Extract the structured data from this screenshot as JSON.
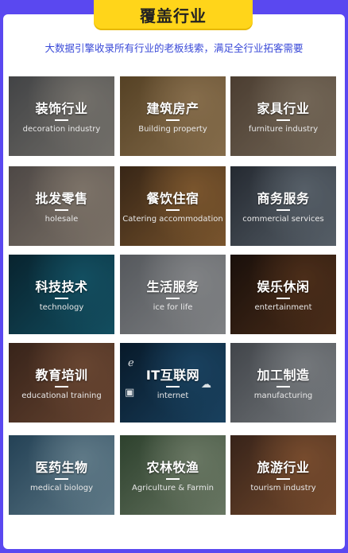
{
  "header": {
    "title": "覆盖行业",
    "subtitle": "大数据引擎收录所有行业的老板线索，满足全行业拓客需要"
  },
  "industries": [
    {
      "cn": "装饰行业",
      "en": "decoration industry",
      "color1": "#6b6d70",
      "color2": "#b9b4ab"
    },
    {
      "cn": "建筑房产",
      "en": "Building property",
      "color1": "#8a6a3c",
      "color2": "#d8b07a"
    },
    {
      "cn": "家具行业",
      "en": "furniture industry",
      "color1": "#7a6450",
      "color2": "#b9a58c"
    },
    {
      "cn": "批发零售",
      "en": "holesale",
      "color1": "#7d7470",
      "color2": "#c9b9a8"
    },
    {
      "cn": "餐饮住宿",
      "en": "Catering accommodation",
      "color1": "#5a3e25",
      "color2": "#c58a4a"
    },
    {
      "cn": "商务服务",
      "en": "commercial services",
      "color1": "#3c4450",
      "color2": "#8c9aa8"
    },
    {
      "cn": "科技技术",
      "en": "technology",
      "color1": "#0e3a4c",
      "color2": "#1f7f9c"
    },
    {
      "cn": "生活服务",
      "en": "ice for life",
      "color1": "#8a8f96",
      "color2": "#cfd2d6"
    },
    {
      "cn": "娱乐休闲",
      "en": "entertainment",
      "color1": "#2a1a12",
      "color2": "#7a4a2a"
    },
    {
      "cn": "教育培训",
      "en": "educational training",
      "color1": "#5a3a2a",
      "color2": "#a87050"
    },
    {
      "cn": "IT互联网",
      "en": "internet",
      "color1": "#0d2a44",
      "color2": "#2a6a9a"
    },
    {
      "cn": "加工制造",
      "en": "manufacturing",
      "color1": "#6a7078",
      "color2": "#bcc2c8"
    },
    {
      "cn": "医药生物",
      "en": "medical biology",
      "color1": "#3a6a8a",
      "color2": "#9ac4da"
    },
    {
      "cn": "农林牧渔",
      "en": "Agriculture & Farmin",
      "color1": "#4a6a4a",
      "color2": "#aac0a0"
    },
    {
      "cn": "旅游行业",
      "en": "tourism industry",
      "color1": "#5a3a2a",
      "color2": "#c07a4a"
    }
  ]
}
